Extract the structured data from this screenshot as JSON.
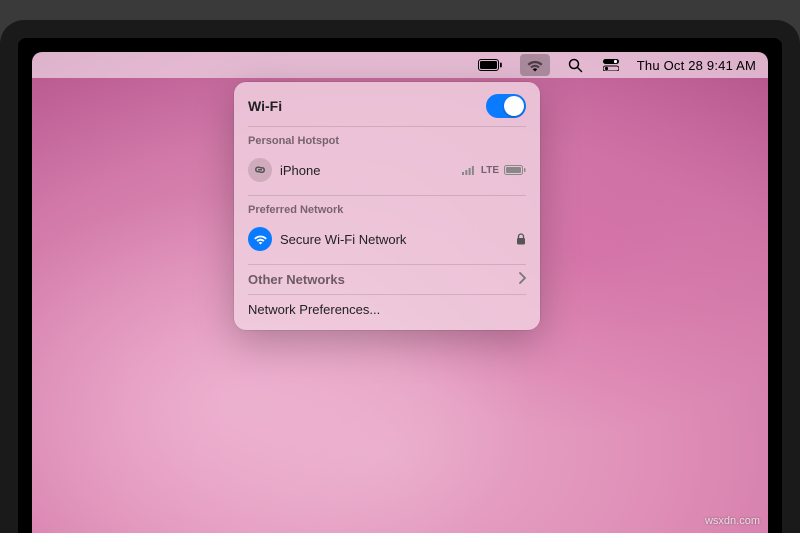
{
  "menubar": {
    "datetime": "Thu Oct 28  9:41 AM"
  },
  "panel": {
    "title": "Wi-Fi",
    "hotspot_label": "Personal Hotspot",
    "hotspot_device": "iPhone",
    "hotspot_signal": "LTE",
    "preferred_label": "Preferred Network",
    "preferred_name": "Secure Wi-Fi Network",
    "other_label": "Other Networks",
    "prefs_label": "Network Preferences..."
  },
  "watermark": "wsxdn.com"
}
